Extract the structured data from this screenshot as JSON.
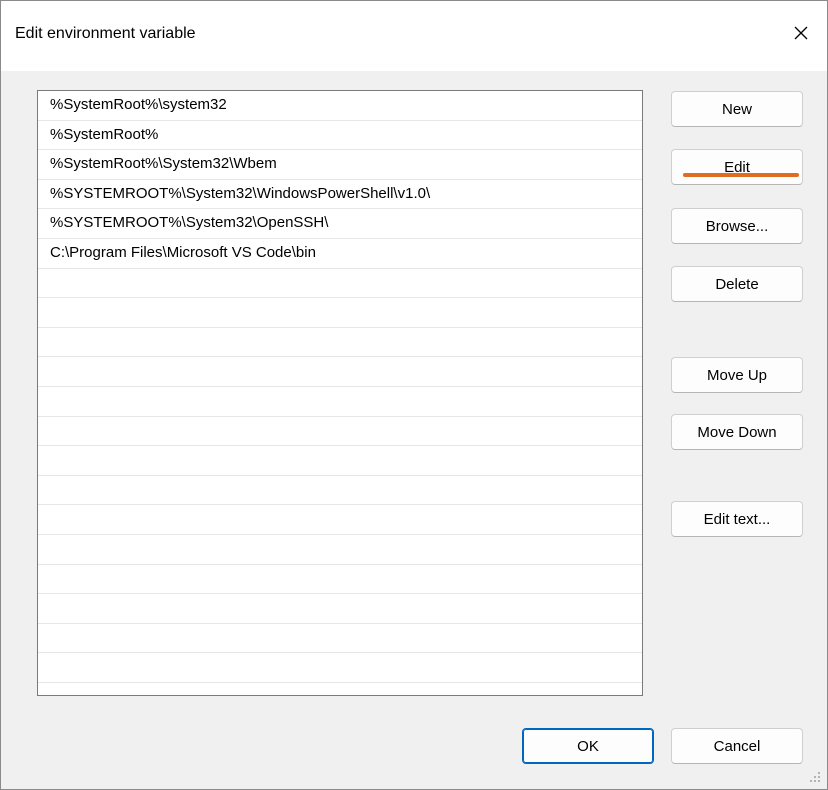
{
  "window": {
    "title": "Edit environment variable"
  },
  "paths": [
    "%SystemRoot%\\system32",
    "%SystemRoot%",
    "%SystemRoot%\\System32\\Wbem",
    "%SYSTEMROOT%\\System32\\WindowsPowerShell\\v1.0\\",
    "%SYSTEMROOT%\\System32\\OpenSSH\\",
    "C:\\Program Files\\Microsoft VS Code\\bin",
    "",
    "",
    "",
    "",
    "",
    "",
    "",
    "",
    "",
    "",
    "",
    "",
    "",
    "",
    ""
  ],
  "buttons": {
    "new": "New",
    "edit": "Edit",
    "browse": "Browse...",
    "delete": "Delete",
    "move_up": "Move Up",
    "move_down": "Move Down",
    "edit_text": "Edit text...",
    "ok": "OK",
    "cancel": "Cancel"
  },
  "icons": {
    "close": "close-icon",
    "resize": "resize-grip-icon"
  },
  "colors": {
    "accent": "#0067c0",
    "highlight": "#e06c1f"
  }
}
